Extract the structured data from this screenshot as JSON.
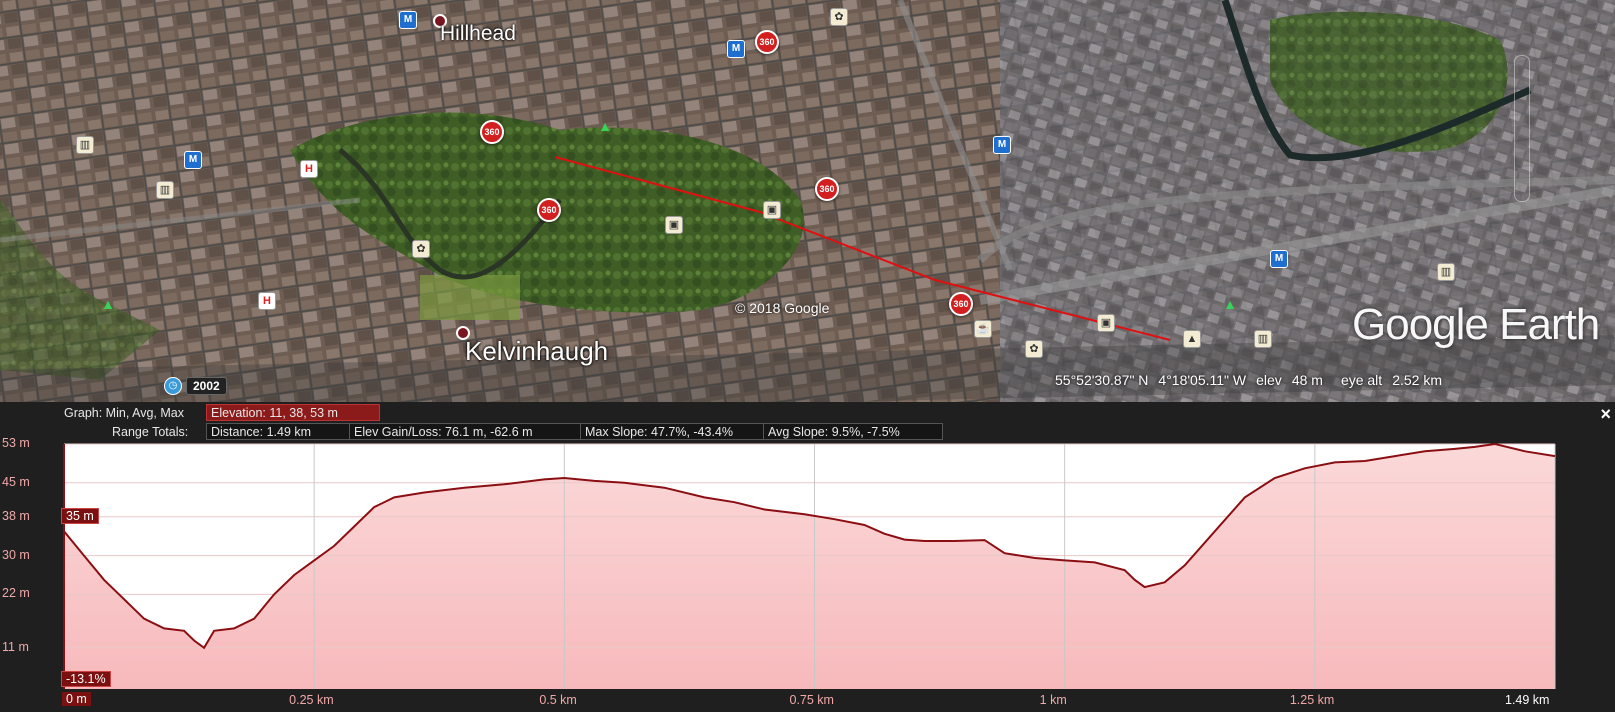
{
  "map": {
    "place_labels": [
      "Hillhead",
      "Kelvinhaugh"
    ],
    "copyright": "© 2018 Google",
    "brand": "Google Earth",
    "year_badge": "2002",
    "pin_label": "360",
    "status": {
      "lat": "55°52'30.87\" N",
      "lon": "4°18'05.11\" W",
      "elev_label": "elev",
      "elev_value": "48 m",
      "eye_alt_label": "eye alt",
      "eye_alt_value": "2.52 km"
    }
  },
  "profile": {
    "graph_label": "Graph: Min, Avg, Max",
    "graph_value": "Elevation: 11, 38, 53 m",
    "range_label": "Range Totals:",
    "distance": "Distance: 1.49 km",
    "gain_loss": "Elev Gain/Loss: 76.1 m, -62.6 m",
    "max_slope": "Max Slope: 47.7%, -43.4%",
    "avg_slope": "Avg Slope: 9.5%, -7.5%",
    "close": "×",
    "start_marker": "35 m",
    "slope_marker": "-13.1%",
    "start_x_label": "0 m"
  },
  "chart_data": {
    "type": "area",
    "xlabel": "",
    "ylabel": "",
    "x_unit": "km",
    "y_unit": "m",
    "xlim": [
      0,
      1.49
    ],
    "ylim": [
      2.5,
      53
    ],
    "x_ticks": [
      "0 m",
      "0.25 km",
      "0.5 km",
      "0.75 km",
      "1 km",
      "1.25 km",
      "1.49 km"
    ],
    "y_ticks": [
      "53 m",
      "45 m",
      "38 m",
      "30 m",
      "22 m",
      "11 m"
    ],
    "y_tick_values": [
      53,
      45,
      38,
      30,
      22,
      11
    ],
    "x": [
      0,
      0.02,
      0.04,
      0.06,
      0.08,
      0.1,
      0.12,
      0.13,
      0.14,
      0.15,
      0.17,
      0.19,
      0.21,
      0.23,
      0.25,
      0.27,
      0.29,
      0.31,
      0.33,
      0.36,
      0.4,
      0.44,
      0.48,
      0.5,
      0.53,
      0.56,
      0.6,
      0.64,
      0.67,
      0.7,
      0.74,
      0.77,
      0.8,
      0.82,
      0.84,
      0.86,
      0.89,
      0.92,
      0.94,
      0.97,
      1.0,
      1.03,
      1.06,
      1.07,
      1.08,
      1.1,
      1.12,
      1.15,
      1.18,
      1.21,
      1.24,
      1.27,
      1.3,
      1.33,
      1.36,
      1.39,
      1.41,
      1.43,
      1.46,
      1.49
    ],
    "series": [
      {
        "values": [
          35,
          30,
          25,
          21,
          17,
          15,
          14.5,
          12.5,
          11,
          14.5,
          15,
          17,
          22,
          26,
          29,
          32,
          36,
          40,
          42,
          43,
          44,
          44.7,
          45.7,
          46,
          45.4,
          45,
          44,
          42,
          41,
          39.5,
          38.5,
          37.5,
          36.3,
          34.5,
          33.3,
          33,
          33,
          33.2,
          30.5,
          29.5,
          29,
          28.6,
          27,
          25,
          23.5,
          24.5,
          28,
          35,
          42,
          46,
          48,
          49.2,
          49.5,
          50.5,
          51.5,
          52,
          52.4,
          53,
          51.5,
          50.5
        ],
        "color": "#8b0e12"
      }
    ],
    "fill_color": "#fde5e5",
    "grid": true
  }
}
